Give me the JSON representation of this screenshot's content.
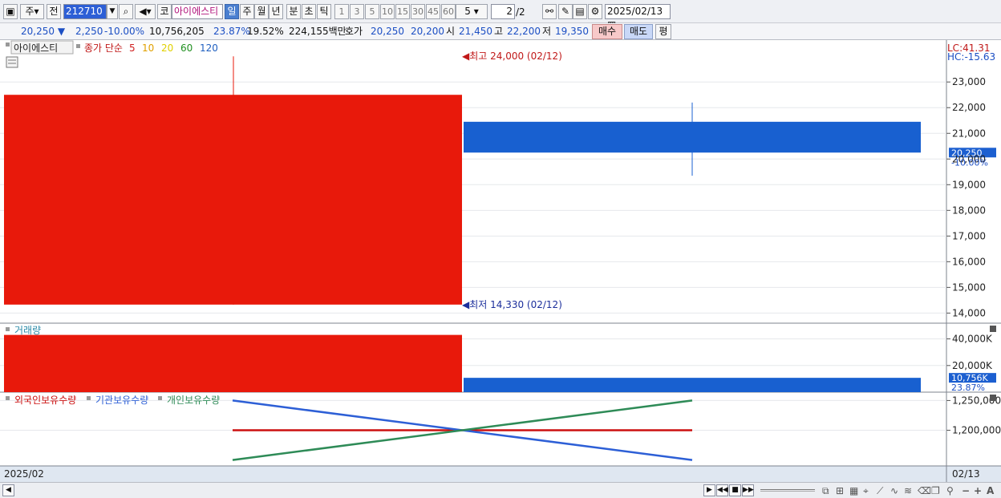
{
  "toolbar": {
    "period_unit": "주",
    "prev_label": "전",
    "stock_code": "212710",
    "market_badge": "코",
    "stock_name": "아이에스티",
    "tabs": [
      "일",
      "주",
      "월",
      "년",
      "분",
      "초",
      "틱"
    ],
    "selected_tab": "일",
    "intervals": [
      "1",
      "3",
      "5",
      "10",
      "15",
      "30",
      "45",
      "60"
    ],
    "interval_select": "5",
    "page_value": "2",
    "page_total": "/2",
    "date": "2025/02/13"
  },
  "quote": {
    "price": "20,250",
    "change_arrow": "▼",
    "change": "2,250",
    "change_pct": "-10.00%",
    "volume": "10,756,205",
    "turnover_pct": "23.87%",
    "ratio_pct": "19.52%",
    "amount": "224,155백만",
    "hoga_label": "호가",
    "ask": "20,250",
    "bid": "20,200",
    "open_label": "시",
    "open": "21,450",
    "high_label": "고",
    "high": "22,200",
    "low_label": "저",
    "low": "19,350",
    "buy_label": "매수",
    "sell_label": "매도",
    "avg_label": "평"
  },
  "price_panel": {
    "title": "아이에스티",
    "ma_label": "종가 단순",
    "ma_periods": [
      "5",
      "10",
      "20",
      "60",
      "120"
    ],
    "ma_colors": [
      "#d02020",
      "#e0a000",
      "#e0d000",
      "#209020",
      "#2060c0"
    ],
    "lc_label": "LC:41.31",
    "hc_label": "HC:-15.63",
    "max_annotation": "최고 24,000 (02/12)",
    "min_annotation": "최저 14,330 (02/12)",
    "current_price_tag": "20,250",
    "current_pct_tag": "-10.00%",
    "y_ticks": [
      "23,000",
      "22,000",
      "21,000",
      "20,000",
      "19,000",
      "18,000",
      "17,000",
      "16,000",
      "15,000",
      "14,000"
    ]
  },
  "volume_panel": {
    "title": "거래량",
    "y_ticks": [
      "40,000K",
      "20,000K"
    ],
    "current_tag": "10,756K",
    "current_pct_tag": "23.87%"
  },
  "holdings_panel": {
    "legend": [
      "외국인보유수량",
      "기관보유수량",
      "개인보유수량"
    ],
    "legend_colors": [
      "#cc1010",
      "#2d5fd6",
      "#2e8b57"
    ],
    "y_ticks": [
      "1,250,000",
      "1,200,000"
    ]
  },
  "footer": {
    "left_date": "2025/02",
    "right_date": "02/13"
  },
  "chart_data": [
    {
      "type": "candlestick",
      "categories": [
        "02/12",
        "02/13"
      ],
      "series": [
        {
          "open": 14330,
          "high": 24000,
          "low": 14330,
          "close": 22500
        },
        {
          "open": 21450,
          "high": 22200,
          "low": 19350,
          "close": 20250
        }
      ],
      "colors": [
        "#e8190b",
        "#1860d0"
      ],
      "ylim": [
        13700,
        24100
      ]
    },
    {
      "type": "bar",
      "title": "거래량",
      "categories": [
        "02/12",
        "02/13"
      ],
      "values": [
        43000,
        10756
      ],
      "colors": [
        "#e8190b",
        "#1860d0"
      ],
      "ylim": [
        0,
        50000
      ]
    },
    {
      "type": "line",
      "categories": [
        "02/12",
        "02/13"
      ],
      "series": [
        {
          "name": "외국인보유수량",
          "values": [
            1200000,
            1200000
          ],
          "color": "#cc1010"
        },
        {
          "name": "기관보유수량",
          "values": [
            1250000,
            1150000
          ],
          "color": "#2d5fd6"
        },
        {
          "name": "개인보유수량",
          "values": [
            1150000,
            1250000
          ],
          "color": "#2e8b57"
        }
      ],
      "ylim": [
        1140000,
        1260000
      ]
    }
  ]
}
